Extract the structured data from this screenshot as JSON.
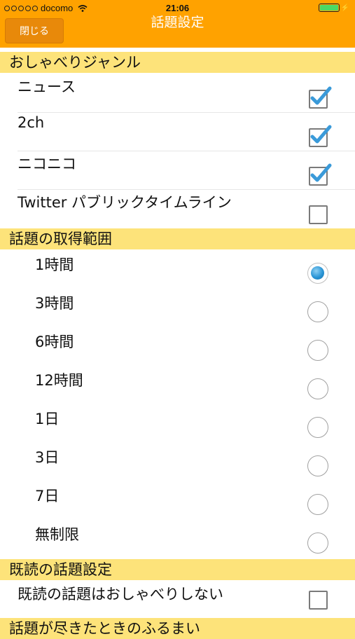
{
  "status_bar": {
    "carrier": "docomo",
    "time": "21:06",
    "signal_icon": "signal-dots-icon",
    "wifi_icon": "wifi-icon",
    "battery_icon": "battery-icon",
    "battery_level": 1.0
  },
  "nav": {
    "title": "話題設定",
    "close_label": "閉じる",
    "bar_color": "#ffa200"
  },
  "sections": {
    "genre": {
      "header": "おしゃべりジャンル",
      "items": [
        {
          "label": "ニュース",
          "checked": true
        },
        {
          "label": "2ch",
          "checked": true
        },
        {
          "label": "ニコニコ",
          "checked": true
        },
        {
          "label": "Twitter パブリックタイムライン",
          "checked": false
        }
      ]
    },
    "range": {
      "header": "話題の取得範囲",
      "items": [
        {
          "label": "1時間",
          "selected": true
        },
        {
          "label": "3時間",
          "selected": false
        },
        {
          "label": "6時間",
          "selected": false
        },
        {
          "label": "12時間",
          "selected": false
        },
        {
          "label": "1日",
          "selected": false
        },
        {
          "label": "3日",
          "selected": false
        },
        {
          "label": "7日",
          "selected": false
        },
        {
          "label": "無制限",
          "selected": false
        }
      ]
    },
    "read": {
      "header": "既読の話題設定",
      "items": [
        {
          "label": "既読の話題はおしゃべりしない",
          "checked": false
        }
      ]
    },
    "exhausted": {
      "header": "話題が尽きたときのふるまい"
    }
  },
  "colors": {
    "header_bg": "#fde37a",
    "accent": "#ffa200",
    "check_blue": "#3a9ad9"
  }
}
